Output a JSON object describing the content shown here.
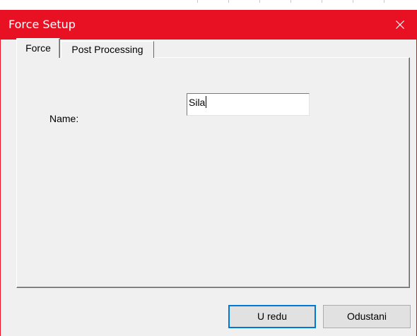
{
  "window": {
    "title": "Force Setup",
    "accent_color": "#e81123",
    "close_icon": "close-icon"
  },
  "tabs": [
    {
      "label": "Force",
      "active": true
    },
    {
      "label": "Post Processing",
      "active": false
    }
  ],
  "form": {
    "name_label": "Name:",
    "name_value": "Sila"
  },
  "buttons": {
    "ok_label": "U redu",
    "cancel_label": "Odustani"
  }
}
